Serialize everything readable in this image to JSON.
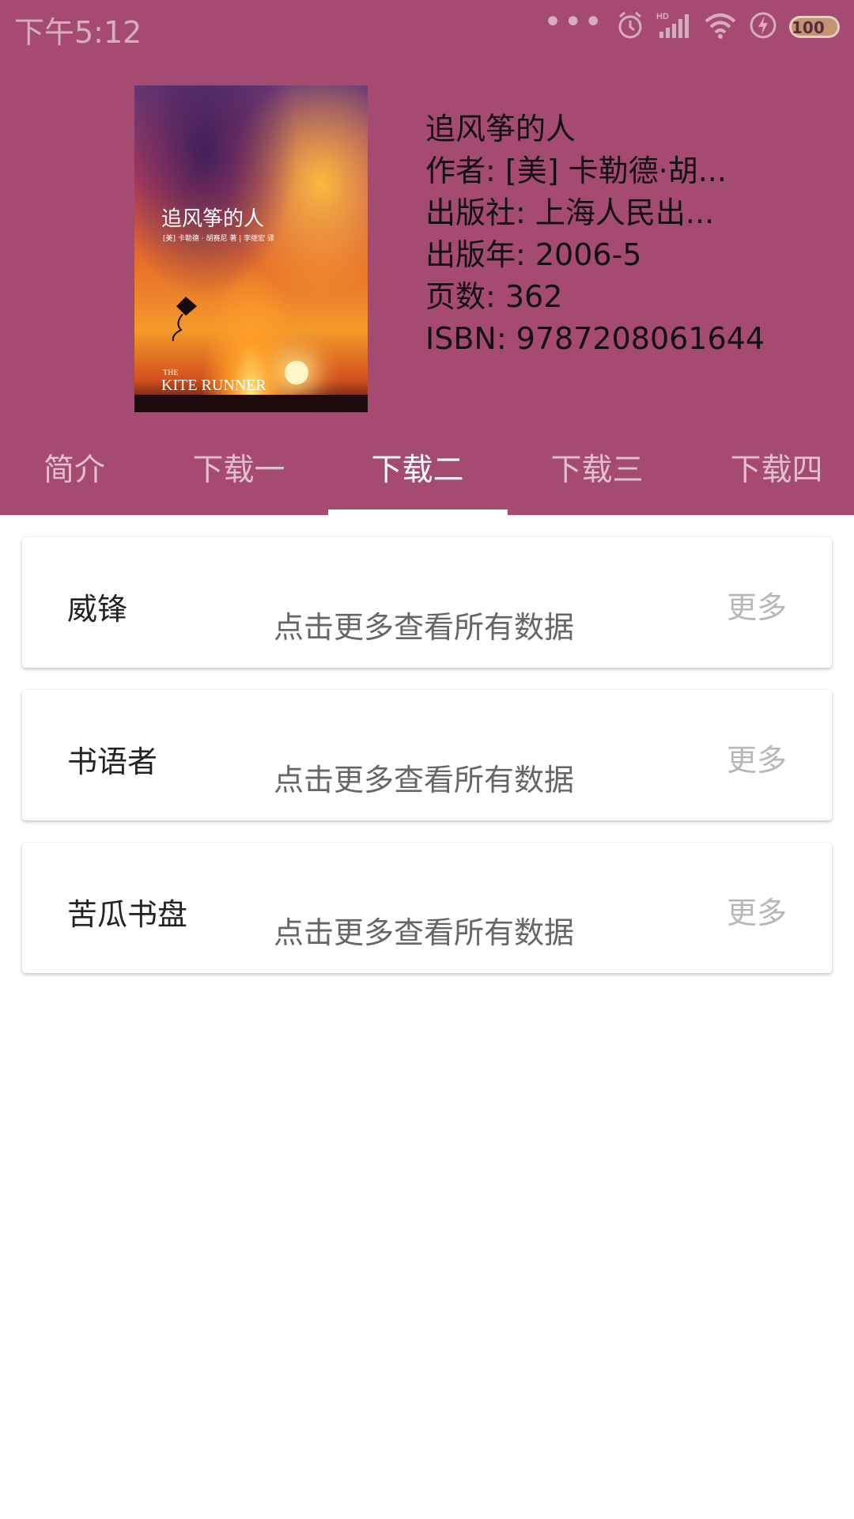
{
  "status_bar": {
    "time": "下午5:12",
    "battery": "100",
    "icons": [
      "more-dots-icon",
      "alarm-icon",
      "hd-signal-icon",
      "wifi-icon",
      "charging-icon",
      "battery-icon"
    ]
  },
  "colors": {
    "header_bg": "#a54a70",
    "tab_indicator": "#ffffff",
    "more_text": "#b7b7b7"
  },
  "book": {
    "cover": {
      "title_cn": "追风筝的人",
      "subtitle_cn": "[美] 卡勒德 · 胡赛尼 著 | 李继宏 译",
      "title_en_small": "THE",
      "title_en": "KITE RUNNER"
    },
    "title": "追风筝的人",
    "author": "作者: [美] 卡勒德·胡...",
    "publisher": "出版社: 上海人民出...",
    "year": "出版年: 2006-5",
    "pages": "页数: 362",
    "isbn": "ISBN: 9787208061644"
  },
  "tabs": [
    {
      "label": "简介"
    },
    {
      "label": "下载一"
    },
    {
      "label": "下载二"
    },
    {
      "label": "下载三"
    },
    {
      "label": "下载四"
    }
  ],
  "active_tab": "下载二",
  "sources": [
    {
      "name": "威锋",
      "desc": "点击更多查看所有数据",
      "more": "更多"
    },
    {
      "name": "书语者",
      "desc": "点击更多查看所有数据",
      "more": "更多"
    },
    {
      "name": "苦瓜书盘",
      "desc": "点击更多查看所有数据",
      "more": "更多"
    }
  ]
}
